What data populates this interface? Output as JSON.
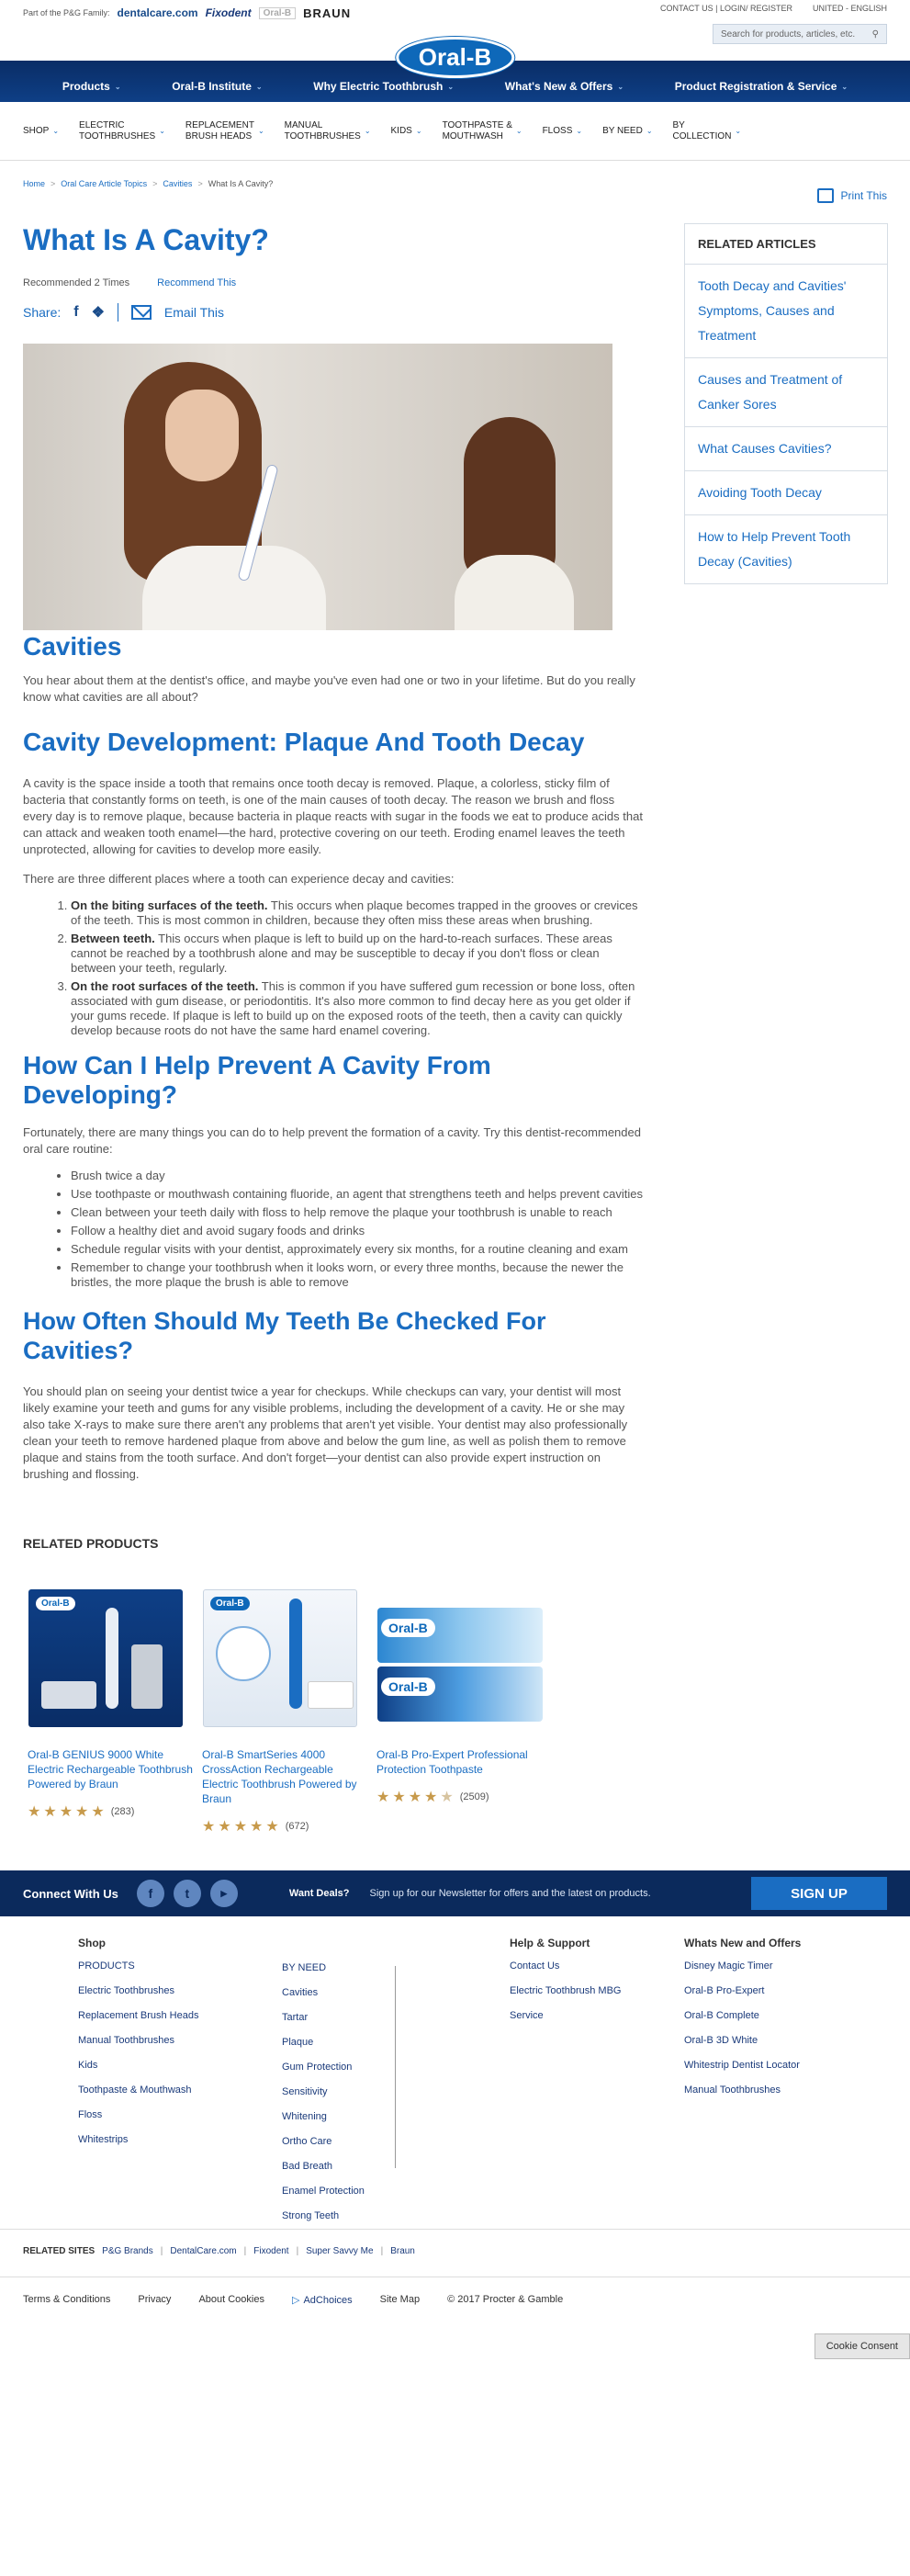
{
  "util": {
    "family": "Part of the P&G Family:",
    "brands": [
      "dentalcare.com",
      "Fixodent",
      "Oral-B",
      "BRAUN"
    ],
    "contact": "CONTACT US",
    "login": "LOGIN/ REGISTER",
    "region": "UNITED - ENGLISH",
    "search_placeholder": "Search for products, articles, etc."
  },
  "logo": "Oral-B",
  "main_nav": [
    "Products",
    "Oral-B Institute",
    "Why Electric Toothbrush",
    "What's New & Offers",
    "Product Registration & Service"
  ],
  "sub_nav": [
    [
      "SHOP",
      ""
    ],
    [
      "ELECTRIC",
      "TOOTHBRUSHES"
    ],
    [
      "REPLACEMENT",
      "BRUSH HEADS"
    ],
    [
      "MANUAL",
      "TOOTHBRUSHES"
    ],
    [
      "KIDS",
      ""
    ],
    [
      "TOOTHPASTE &",
      "MOUTHWASH"
    ],
    [
      "FLOSS",
      ""
    ],
    [
      "BY NEED",
      ""
    ],
    [
      "BY",
      "COLLECTION"
    ]
  ],
  "breadcrumb": [
    "Home",
    "Oral Care Article Topics",
    "Cavities",
    "What Is A Cavity?"
  ],
  "print": "Print This",
  "article": {
    "title": "What Is A Cavity?",
    "recommended": "Recommended 2 Times",
    "recommend_this": "Recommend This",
    "share": "Share:",
    "email": "Email This",
    "h_cavities": "Cavities",
    "intro": "You hear about them at the dentist's office, and maybe you've even had one or two in your lifetime. But do you really know what cavities are all about?",
    "h_dev": "Cavity Development: Plaque And Tooth Decay",
    "dev_p1": "A cavity is the space inside a tooth that remains once tooth decay is removed. Plaque, a colorless, sticky film of bacteria that constantly forms on teeth, is one of the main causes of tooth decay. The reason we brush and floss every day is to remove plaque, because bacteria in plaque reacts with sugar in the foods we eat to produce acids that can attack and weaken tooth enamel—the hard, protective covering on our teeth. Eroding enamel leaves the teeth unprotected, allowing for cavities to develop more easily.",
    "dev_p2": "There are three different places where a tooth can experience decay and cavities:",
    "places": [
      {
        "b": "On the biting surfaces of the teeth.",
        "t": " This occurs when plaque becomes trapped in the grooves or crevices of the teeth. This is most common in children, because they often miss these areas when brushing."
      },
      {
        "b": "Between teeth.",
        "t": " This occurs when plaque is left to build up on the hard-to-reach surfaces. These areas cannot be reached by a toothbrush alone and may be susceptible to decay if you don't floss or clean between your teeth, regularly."
      },
      {
        "b": "On the root surfaces of the teeth.",
        "t": " This is common if you have suffered gum recession or bone loss, often associated with gum disease, or periodontitis. It's also more common to find decay here as you get older if your gums recede. If plaque is left to build up on the exposed roots of the teeth, then a cavity can quickly develop because roots do not have the same hard enamel covering."
      }
    ],
    "h_prevent": "How Can I Help Prevent A Cavity From Developing?",
    "prevent_p": "Fortunately, there are many things you can do to help prevent the formation of a cavity. Try this dentist-recommended oral care routine:",
    "prevent_list": [
      "Brush twice a day",
      "Use toothpaste or mouthwash containing fluoride, an agent that strengthens teeth and helps prevent cavities",
      "Clean between your teeth daily with floss to help remove the plaque your toothbrush is unable to reach",
      "Follow a healthy diet and avoid sugary foods and drinks",
      "Schedule regular visits with your dentist, approximately every six months, for a routine cleaning and exam",
      "Remember to change your toothbrush when it looks worn, or every three months, because the newer the bristles, the more plaque the brush is able to remove"
    ],
    "h_often": "How Often Should My Teeth Be Checked For Cavities?",
    "often_p": "You should plan on seeing your dentist twice a year for checkups. While checkups can vary, your dentist will most likely examine your teeth and gums for any visible problems, including the development of a cavity. He or she may also take X-rays to make sure there aren't any problems that aren't yet visible. Your dentist may also professionally clean your teeth to remove hardened plaque from above and below the gum line, as well as polish them to remove plaque and stains from the tooth surface. And don't forget—your dentist can also provide expert instruction on brushing and flossing."
  },
  "related_articles": {
    "title": "RELATED ARTICLES",
    "items": [
      "Tooth Decay and Cavities' Symptoms, Causes and Treatment",
      "Causes and Treatment of Canker Sores",
      "What Causes Cavities?",
      "Avoiding Tooth Decay",
      "How to Help Prevent Tooth Decay (Cavities)"
    ]
  },
  "related_products": {
    "title": "RELATED PRODUCTS",
    "items": [
      {
        "name": "Oral-B GENIUS 9000 White Electric Rechargeable Toothbrush Powered by Braun",
        "rating": 5,
        "count": "(283)"
      },
      {
        "name": "Oral-B SmartSeries 4000 CrossAction Rechargeable Electric Toothbrush Powered by Braun",
        "rating": 5,
        "count": "(672)"
      },
      {
        "name": "Oral-B Pro-Expert Professional Protection Toothpaste",
        "rating": 4,
        "count": "(2509)"
      }
    ]
  },
  "connect": {
    "label": "Connect With Us",
    "deals": "Want Deals?",
    "newsletter": "Sign up for our Newsletter for offers and the latest on products.",
    "signup": "SIGN UP"
  },
  "footer": {
    "shop_title": "Shop",
    "shop_col1": [
      "PRODUCTS",
      "Electric Toothbrushes",
      "Replacement Brush Heads",
      "Manual Toothbrushes",
      "Kids",
      "Toothpaste & Mouthwash",
      "Floss",
      "Whitestrips"
    ],
    "shop_col2": [
      "BY NEED",
      "Cavities",
      "Tartar",
      "Plaque",
      "Gum Protection",
      "Sensitivity",
      "Whitening",
      "Ortho Care",
      "Bad Breath",
      "Enamel Protection",
      "Strong Teeth"
    ],
    "help_title": "Help & Support",
    "help": [
      "Contact Us",
      "Electric Toothbrush MBG",
      "Service"
    ],
    "new_title": "Whats New and Offers",
    "new": [
      "Disney Magic Timer",
      "Oral-B Pro-Expert",
      "Oral-B Complete",
      "Oral-B 3D White",
      "Whitestrip Dentist Locator",
      "Manual Toothbrushes"
    ],
    "related_sites_label": "RELATED SITES",
    "related_sites": [
      "P&G Brands",
      "DentalCare.com",
      "Fixodent",
      "Super Savvy Me",
      "Braun"
    ],
    "legal": [
      "Terms & Conditions",
      "Privacy",
      "About Cookies",
      "AdChoices",
      "Site Map",
      "© 2017 Procter & Gamble"
    ],
    "cookie": "Cookie Consent"
  }
}
